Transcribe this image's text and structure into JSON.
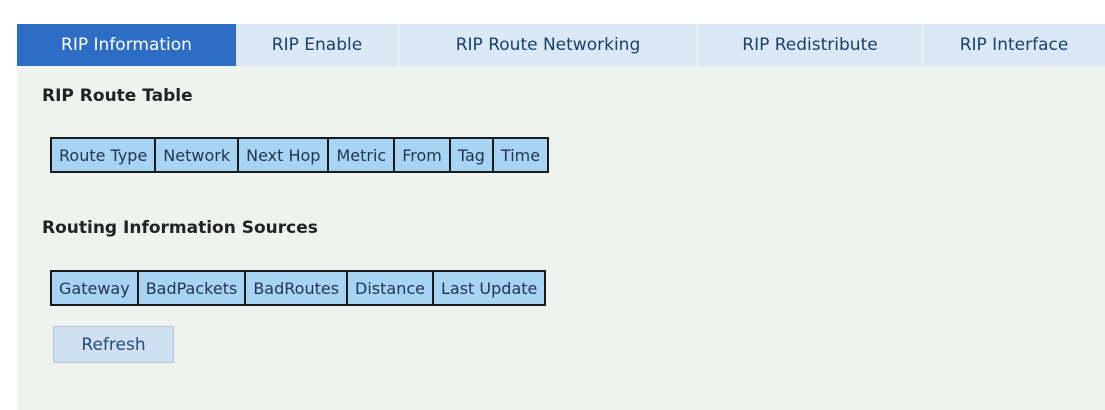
{
  "tabs": [
    {
      "label": "RIP Information",
      "active": true
    },
    {
      "label": "RIP Enable",
      "active": false
    },
    {
      "label": "RIP Route Networking",
      "active": false
    },
    {
      "label": "RIP Redistribute",
      "active": false
    },
    {
      "label": "RIP Interface",
      "active": false
    }
  ],
  "route_table": {
    "title": "RIP Route Table",
    "columns": [
      "Route Type",
      "Network",
      "Next Hop",
      "Metric",
      "From",
      "Tag",
      "Time"
    ]
  },
  "sources_table": {
    "title": "Routing Information Sources",
    "columns": [
      "Gateway",
      "BadPackets",
      "BadRoutes",
      "Distance",
      "Last Update"
    ]
  },
  "refresh_label": "Refresh",
  "colors": {
    "active_tab": "#2e6dc5",
    "tab_bar": "#dbe9f6",
    "table_header": "#a8d4f4",
    "panel": "#eef3ef"
  }
}
